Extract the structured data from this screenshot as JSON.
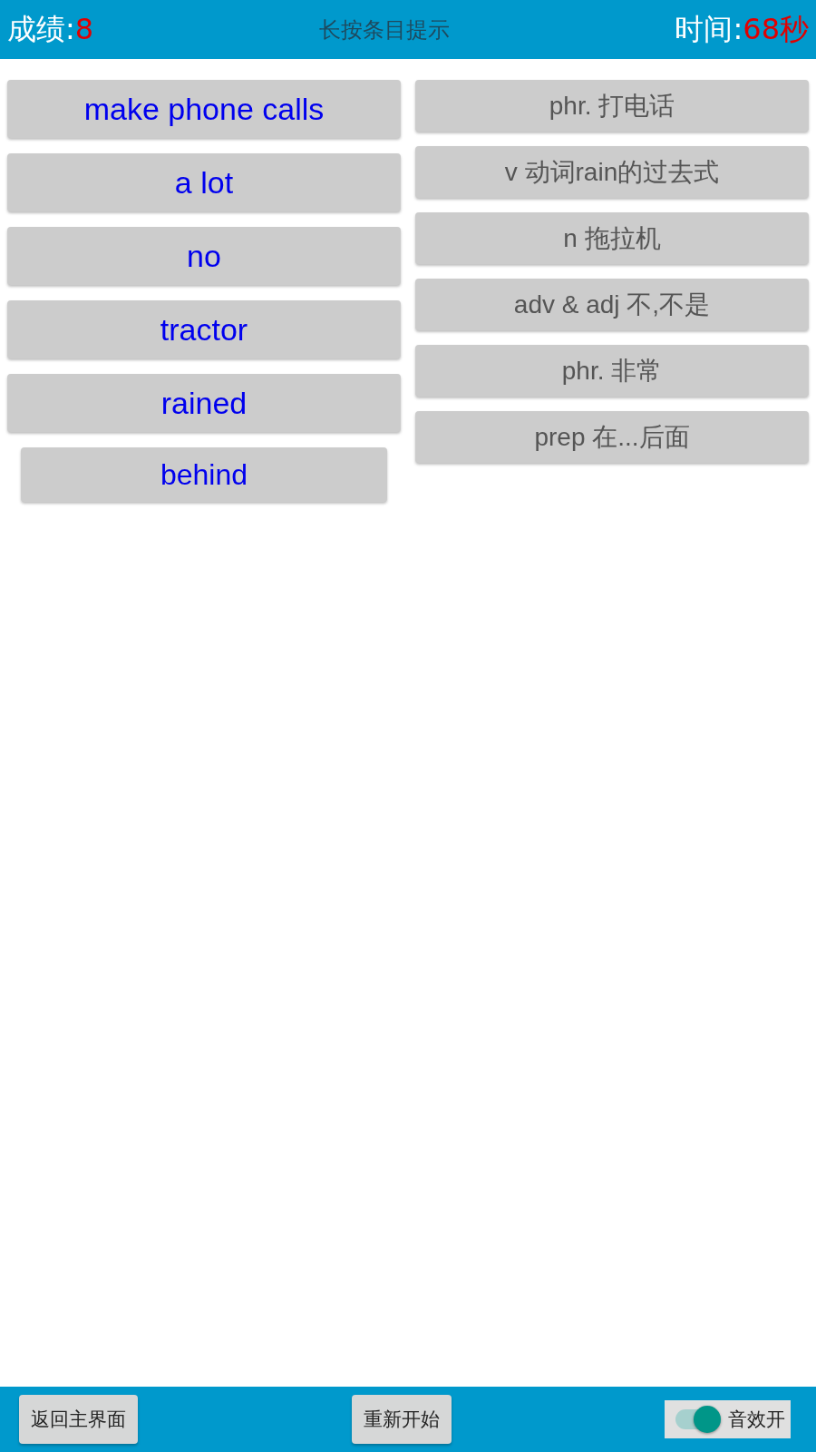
{
  "header": {
    "score_label": "成绩:",
    "score": "8",
    "hint": "长按条目提示",
    "time_label": "时间:",
    "time": "68秒"
  },
  "words": [
    {
      "text": "make phone calls",
      "pressed": false
    },
    {
      "text": "a lot",
      "pressed": false
    },
    {
      "text": "no",
      "pressed": false
    },
    {
      "text": "tractor",
      "pressed": false
    },
    {
      "text": "rained",
      "pressed": false
    },
    {
      "text": "behind",
      "pressed": true
    }
  ],
  "meanings": [
    "phr. 打电话",
    "v 动词rain的过去式",
    "n 拖拉机",
    "adv & adj 不,不是",
    "phr. 非常",
    "prep 在...后面"
  ],
  "footer": {
    "buttons": [
      "返回主界面",
      "重新开始"
    ],
    "sound_switch": {
      "label": "音效开",
      "on": true
    }
  }
}
